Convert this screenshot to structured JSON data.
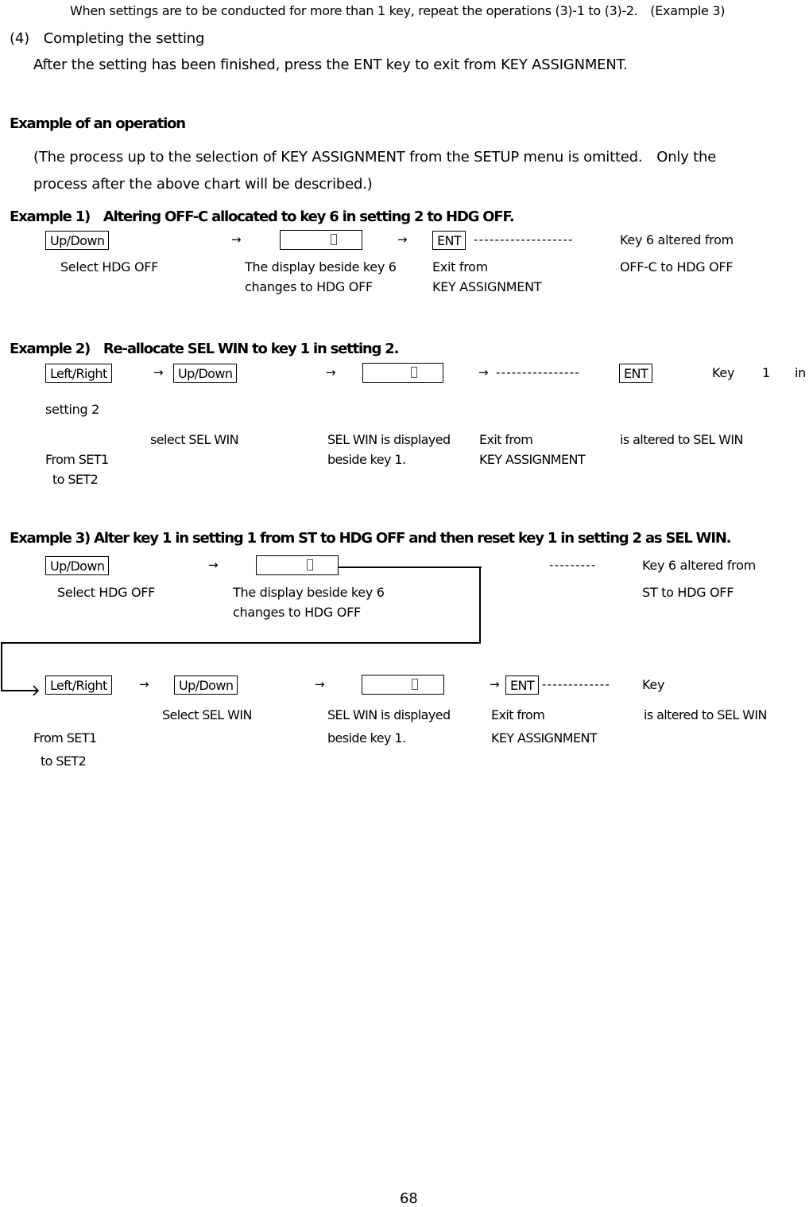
{
  "intro_line": "When settings are to be conducted for more than 1 key, repeat the operations (3)-1 to (3)-2.　(Example 3)",
  "section4": {
    "heading": "(4)　Completing the setting",
    "body": "After the setting has been finished, press the ENT key to exit from KEY ASSIGNMENT."
  },
  "example_of_operation": {
    "heading": "Example of an operation",
    "note_line1": "(The process up to the selection of KEY ASSIGNMENT from the SETUP menu is omitted.　Only the",
    "note_line2": "process after the above chart will be described.)"
  },
  "example1": {
    "heading": "Example 1)　Altering OFF-C allocated to key 6 in setting 2 to HDG OFF.",
    "keys": {
      "updown": "Up/Down",
      "ent": "ENT"
    },
    "arrow": "→",
    "dashes": "-------------------",
    "result_line1": "Key 6 altered from",
    "result_line2": "OFF-C to HDG OFF",
    "caption_select": "Select HDG OFF",
    "caption_display_1": "The display beside key 6",
    "caption_display_2": "changes to HDG OFF",
    "caption_exit_1": "Exit from",
    "caption_exit_2": "KEY ASSIGNMENT"
  },
  "example2": {
    "heading": "Example 2)　Re-allocate SEL WIN to key 1 in setting 2.",
    "keys": {
      "leftright": "Left/Right",
      "updown": "Up/Down",
      "ent": "ENT"
    },
    "arrow": "→",
    "dashes": "----------------",
    "result_word1": "Key",
    "result_word2": "1",
    "result_word3": "in",
    "result_line2": "setting 2",
    "caption_from_1": "From SET1",
    "caption_from_2": "to SET2",
    "caption_select": "select SEL WIN",
    "caption_display_1": "SEL WIN is displayed",
    "caption_display_2": "beside key 1.",
    "caption_exit_1": "Exit from",
    "caption_exit_2": "KEY ASSIGNMENT",
    "caption_result": "is altered to SEL WIN"
  },
  "example3": {
    "heading": "Example 3) Alter key 1 in setting 1 from ST to HDG OFF and then reset key 1 in setting 2 as SEL WIN.",
    "row1": {
      "keys": {
        "updown": "Up/Down"
      },
      "arrow": "→",
      "dashes": "---------",
      "result_line1": "Key 6 altered from",
      "result_line2": "ST to HDG OFF",
      "caption_select": "Select HDG OFF",
      "caption_display_1": "The display beside key 6",
      "caption_display_2": "changes to HDG OFF"
    },
    "row2": {
      "keys": {
        "leftright": "Left/Right",
        "updown": "Up/Down",
        "ent": "ENT"
      },
      "arrow": "→",
      "dashes": "-------------",
      "result_line1": "Key",
      "caption_select": "Select SEL WIN",
      "caption_display_1": "SEL WIN is displayed",
      "caption_display_2": "beside key 1.",
      "caption_exit_1": "Exit from",
      "caption_exit_2": "KEY ASSIGNMENT",
      "caption_result": "is altered to SEL WIN",
      "caption_from_1": "From SET1",
      "caption_from_2": "to SET2"
    }
  },
  "page_number": "68"
}
